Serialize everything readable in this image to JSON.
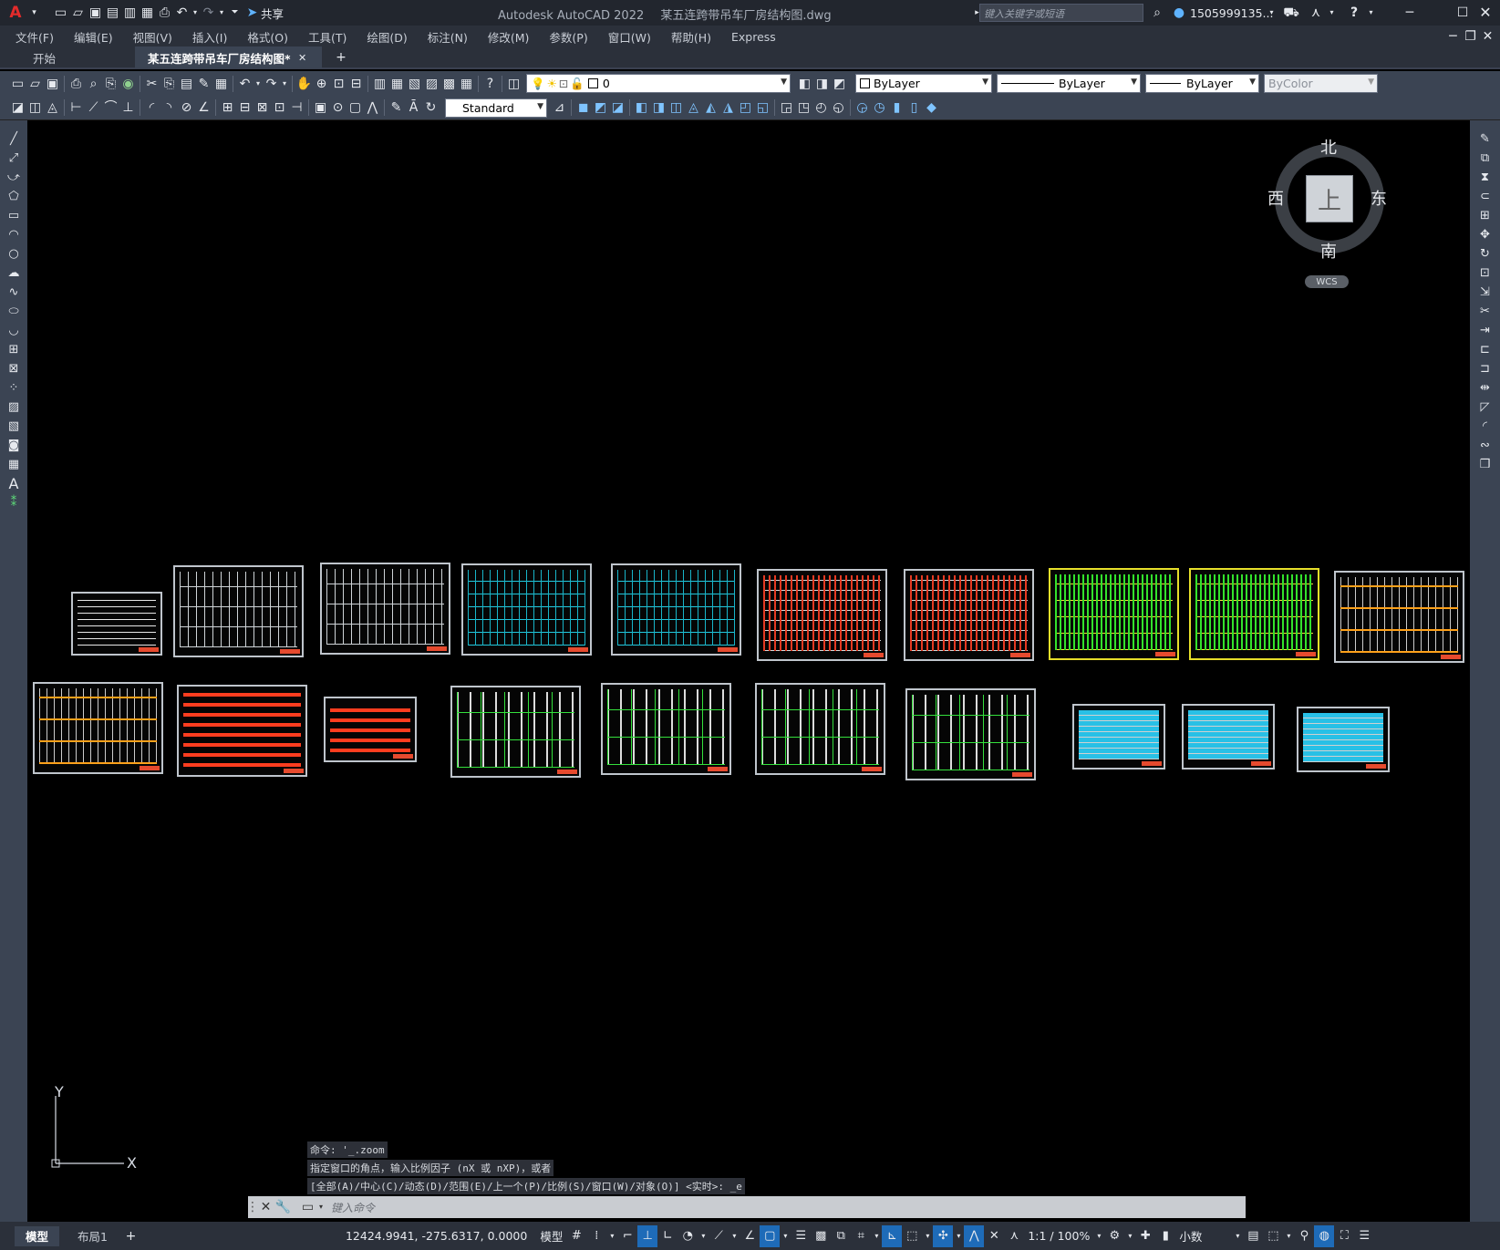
{
  "titlebar": {
    "app_title": "Autodesk AutoCAD 2022",
    "file_name": "某五连跨带吊车厂房结构图.dwg",
    "share_label": "共享",
    "search_placeholder": "键入关键字或短语",
    "user_name": "1505999135..."
  },
  "menu": [
    {
      "label": "文件(F)"
    },
    {
      "label": "编辑(E)"
    },
    {
      "label": "视图(V)"
    },
    {
      "label": "插入(I)"
    },
    {
      "label": "格式(O)"
    },
    {
      "label": "工具(T)"
    },
    {
      "label": "绘图(D)"
    },
    {
      "label": "标注(N)"
    },
    {
      "label": "修改(M)"
    },
    {
      "label": "参数(P)"
    },
    {
      "label": "窗口(W)"
    },
    {
      "label": "帮助(H)"
    },
    {
      "label": "Express"
    }
  ],
  "tabs": [
    {
      "label": "开始"
    },
    {
      "label": "某五连跨带吊车厂房结构图*"
    }
  ],
  "layers": {
    "current_layer": "0",
    "color": "ByLayer",
    "linetype": "ByLayer",
    "lineweight": "ByLayer",
    "plotstyle": "ByColor"
  },
  "styles": {
    "text_style": "Standard"
  },
  "viewcube": {
    "north": "北",
    "south": "南",
    "east": "东",
    "west": "西",
    "face": "上",
    "wcs_label": "WCS"
  },
  "ucs": {
    "x_label": "X",
    "y_label": "Y"
  },
  "command": {
    "history": [
      "命令: '_.zoom",
      "指定窗口的角点，输入比例因子 (nX 或 nXP)，或者",
      "[全部(A)/中心(C)/动态(D)/范围(E)/上一个(P)/比例(S)/窗口(W)/对象(O)] <实时>: _e"
    ],
    "placeholder": "键入命令"
  },
  "status": {
    "tabs": [
      {
        "label": "模型"
      },
      {
        "label": "布局1"
      }
    ],
    "coordinates": "12424.9941, -275.6317, 0.0000",
    "space": "模型",
    "scale": "1:1 / 100%",
    "units": "小数"
  }
}
